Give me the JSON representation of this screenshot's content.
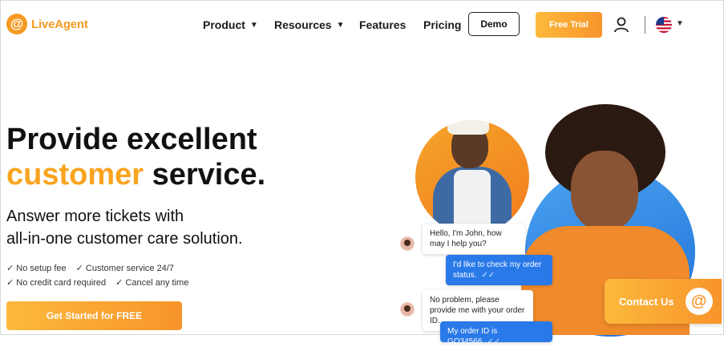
{
  "header": {
    "logo_text": "LiveAgent",
    "nav": [
      {
        "label": "Product",
        "has_dropdown": true
      },
      {
        "label": "Resources",
        "has_dropdown": true
      },
      {
        "label": "Features",
        "has_dropdown": false
      },
      {
        "label": "Pricing",
        "has_dropdown": false
      }
    ],
    "demo_label": "Demo",
    "trial_label": "Free Trial",
    "icons": [
      "user-icon",
      "us-flag-icon",
      "chevron-down-icon"
    ]
  },
  "hero": {
    "headline_line1": "Provide excellent",
    "headline_accent": "customer",
    "headline_rest": " service.",
    "sub_line1": "Answer more tickets with",
    "sub_line2": "all-in-one customer care solution.",
    "features_row1": [
      "✓ No setup fee",
      "✓ Customer service 24/7"
    ],
    "features_row2": [
      "✓ No credit card required",
      "✓ Cancel any time"
    ],
    "cta_label": "Get Started for FREE"
  },
  "chat": {
    "messages": [
      {
        "from": "agent",
        "text": "Hello, I'm John, how may I help you?"
      },
      {
        "from": "customer",
        "text": "I'd like to check my order status."
      },
      {
        "from": "agent",
        "text": "No problem, please provide me with your order ID."
      },
      {
        "from": "customer",
        "text": "My order ID is GQ34566"
      }
    ]
  },
  "contact_widget": {
    "label": "Contact Us"
  },
  "colors": {
    "accent": "#f9a41f",
    "blue": "#2979e8",
    "text": "#111111"
  }
}
